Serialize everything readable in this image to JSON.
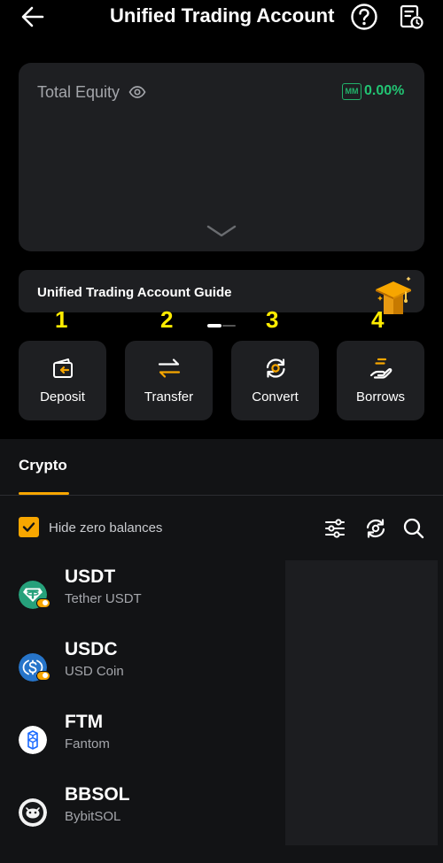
{
  "header": {
    "title": "Unified Trading Account"
  },
  "equity": {
    "label": "Total Equity",
    "mm_badge": "MM",
    "mm_value": "0.00%",
    "accent_color": "#22c373"
  },
  "guide": {
    "label": "Unified Trading Account Guide"
  },
  "annotations": [
    "1",
    "2",
    "3",
    "4"
  ],
  "actions": [
    {
      "label": "Deposit",
      "icon": "deposit-icon"
    },
    {
      "label": "Transfer",
      "icon": "transfer-icon"
    },
    {
      "label": "Convert",
      "icon": "convert-icon"
    },
    {
      "label": "Borrows",
      "icon": "borrows-icon"
    }
  ],
  "tabs": [
    {
      "label": "Crypto",
      "active": true
    }
  ],
  "filters": {
    "hide_zero_label": "Hide zero balances",
    "hide_zero_checked": true
  },
  "assets": [
    {
      "symbol": "USDT",
      "name": "Tether USDT",
      "icon": "usdt-icon"
    },
    {
      "symbol": "USDC",
      "name": "USD Coin",
      "icon": "usdc-icon"
    },
    {
      "symbol": "FTM",
      "name": "Fantom",
      "icon": "ftm-icon"
    },
    {
      "symbol": "BBSOL",
      "name": "BybitSOL",
      "icon": "bbsol-icon"
    }
  ],
  "colors": {
    "brand_orange": "#f7a600",
    "annotation_yellow": "#ffec00",
    "card_bg": "#1e1f22"
  }
}
